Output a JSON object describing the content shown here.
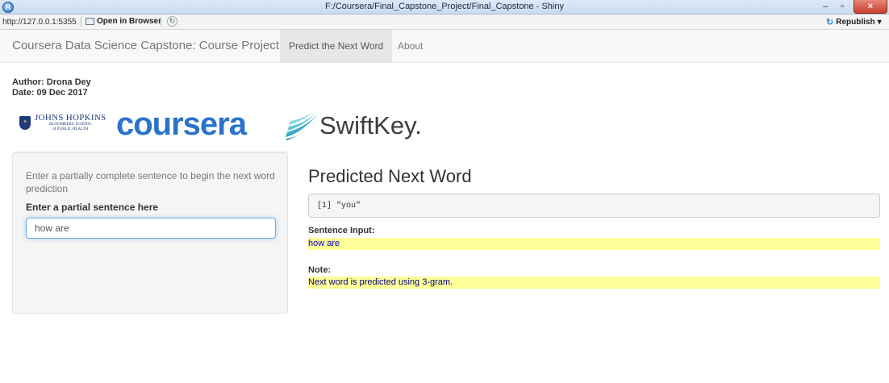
{
  "window": {
    "title": "F:/Coursera/Final_Capstone_Project/Final_Capstone - Shiny",
    "min_glyph": "–",
    "max_glyph": "▫",
    "close_glyph": "×"
  },
  "toolbar": {
    "url": "http://127.0.0.1:5355",
    "open_in_browser": "Open in Browser",
    "republish": "Republish",
    "republish_caret": "▾"
  },
  "navbar": {
    "brand": "Coursera Data Science Capstone: Course Project",
    "tabs": [
      {
        "label": "Predict the Next Word",
        "active": true
      },
      {
        "label": "About",
        "active": false
      }
    ]
  },
  "header": {
    "author": "Author: Drona Dey",
    "date": "Date: 09 Dec 2017"
  },
  "logos": {
    "jhu_line1": "JOHNS HOPKINS",
    "jhu_line2": "BLOOMBERG SCHOOL",
    "jhu_line3": "of PUBLIC HEALTH",
    "coursera": "coursera",
    "swiftkey": "SwiftKey."
  },
  "sidebar": {
    "help_text": "Enter a partially complete sentence to begin the next word prediction",
    "input_label": "Enter a partial sentence here",
    "input_value": "how are"
  },
  "main": {
    "heading": "Predicted Next Word",
    "prediction_output": "[1] \"you\"",
    "sentence_input_label": "Sentence Input:",
    "sentence_input_value": "how are",
    "note_label": "Note:",
    "note_value": "Next word is predicted using 3-gram."
  },
  "colors": {
    "highlight": "#ffff99",
    "coursera_blue": "#2a73cc",
    "input_focus": "#66afe9"
  }
}
